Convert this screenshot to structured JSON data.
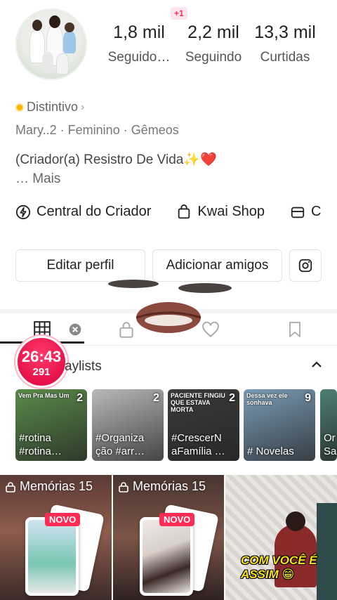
{
  "header": {
    "new_badge": "+1"
  },
  "stats": [
    {
      "value": "1,8 mil",
      "label": "Seguido…"
    },
    {
      "value": "2,2 mil",
      "label": "Seguindo"
    },
    {
      "value": "13,3 mil",
      "label": "Curtidas"
    }
  ],
  "profile": {
    "badge_label": "Distintivo",
    "meta": "Mary..2 · Feminino · Gêmeos",
    "bio": "(Criador(a) Resistro De Vida✨❤️",
    "more": "…  Mais"
  },
  "links": [
    {
      "label": "Central do Criador",
      "icon": "lightning-icon"
    },
    {
      "label": "Kwai Shop",
      "icon": "shopping-bag-icon"
    },
    {
      "label": "C",
      "icon": "store-icon"
    }
  ],
  "buttons": {
    "edit": "Editar perfil",
    "add_friends": "Adicionar amigos"
  },
  "timer": {
    "time": "26:43",
    "coins": "291"
  },
  "playlists": {
    "label": "aylists",
    "items": [
      {
        "count": "2",
        "caption": "#rotina #rotina…",
        "overlay": "Vem Pra Mas Um",
        "bg": "#5a8a4a"
      },
      {
        "count": "2",
        "caption": "#Organiza ção #arr…",
        "overlay": "",
        "bg": "#b9b9b9"
      },
      {
        "count": "2",
        "caption": "#CrescerN aFamília …",
        "overlay": "PACIENTE FINGIU QUE ESTAVA MORTA",
        "bg": "#3b3b3b"
      },
      {
        "count": "9",
        "caption": "# Novelas",
        "overlay": "Dessa vez ele sonhava",
        "bg": "#7a9bb5"
      },
      {
        "count": "",
        "caption": "Or Sa",
        "overlay": "",
        "bg": "#4e7f73"
      }
    ]
  },
  "videos": [
    {
      "title": "Memórias 15",
      "tag": "NOVO"
    },
    {
      "title": "Memórias 15",
      "tag": "NOVO"
    },
    {
      "caption": "COM VOCÊ É ASSIM 😁"
    }
  ],
  "colors": {
    "accent": "#fe2c55",
    "timer": "#e6114a",
    "coin": "#f7b500"
  }
}
